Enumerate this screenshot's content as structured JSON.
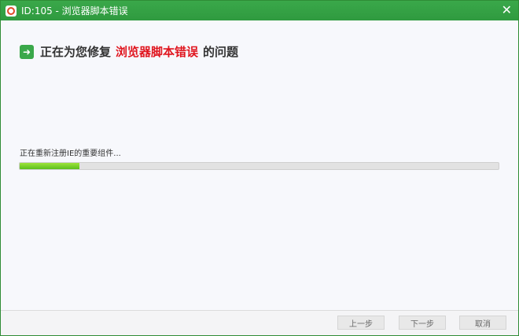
{
  "window": {
    "title": "ID:105 - 浏览器脚本错误",
    "close_symbol": "✕"
  },
  "heading": {
    "prefix": "正在为您修复",
    "highlight": "浏览器脚本错误",
    "suffix": "的问题"
  },
  "task": {
    "status_text": "正在重新注册IE的重要组件...",
    "progress_percent": 12.5
  },
  "buttons": {
    "prev": "上一步",
    "next": "下一步",
    "cancel": "取消"
  },
  "colors": {
    "titlebar": "#3aa84a",
    "highlight": "#e0161f",
    "progress": "#8ed32b"
  },
  "icons": {
    "app": "lifebuoy-icon",
    "heading": "arrow-right-icon"
  }
}
